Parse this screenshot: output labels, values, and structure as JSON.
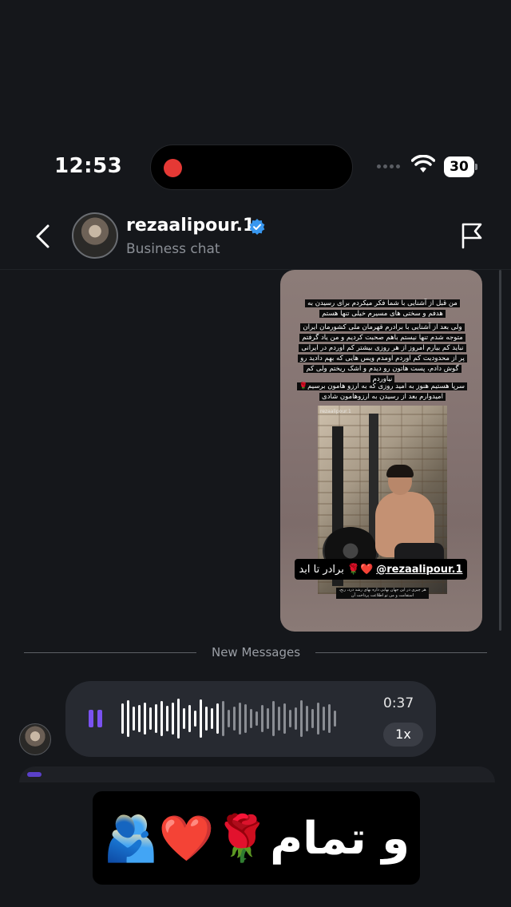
{
  "status_bar": {
    "time": "12:53",
    "battery": "30"
  },
  "header": {
    "username": "rezaalipour.1",
    "subtitle": "Business chat"
  },
  "story": {
    "text_1": "من قبل از آشنایی با شما فکر میکردم برای رسیدن به هدفم و سختی های مسیرم خیلی تنها هستم",
    "text_2": "ولی بعد از آشنایی با برادرم قهرمان ملی کشورمان ایران متوجه شدم تنها نیستم باهم صحبت کردیم و من یاد گرفتم نباید کم بیارم امروز از هر روزی بیشتر کم اوردم در ایرانی پر از محدودیت کم اوردم اومدم ویس هایی که بهم دادید رو گوش دادم، پست هاتون رو دیدم و اشک ریختم ولی کم نیاوردم",
    "text_3": "سرپا هستیم هنوز به امید روزی که به ارزو هامون برسیم🌹 امیدوارم بعد از رسیدن به ارزوهامون شادی",
    "watermark": "rezaalipour.1",
    "mention_handle": "@rezaalipour.1",
    "mention_text": "برادر تا ابد",
    "mention_emoji": "🌹❤️",
    "footer_text": "هر چیزی در این جهان بهایی داره بهای رشد درد، رنج، استقامت و من تو اطلاعت پرداخت آن"
  },
  "divider": {
    "label": "New Messages"
  },
  "voice_message": {
    "duration": "0:37",
    "speed": "1x",
    "progress": 0.45
  },
  "caption": {
    "text": "و تمام🌹❤️🫂"
  },
  "colors": {
    "accent": "#7a52f0",
    "verified": "#3897f0",
    "record": "#e53935"
  }
}
